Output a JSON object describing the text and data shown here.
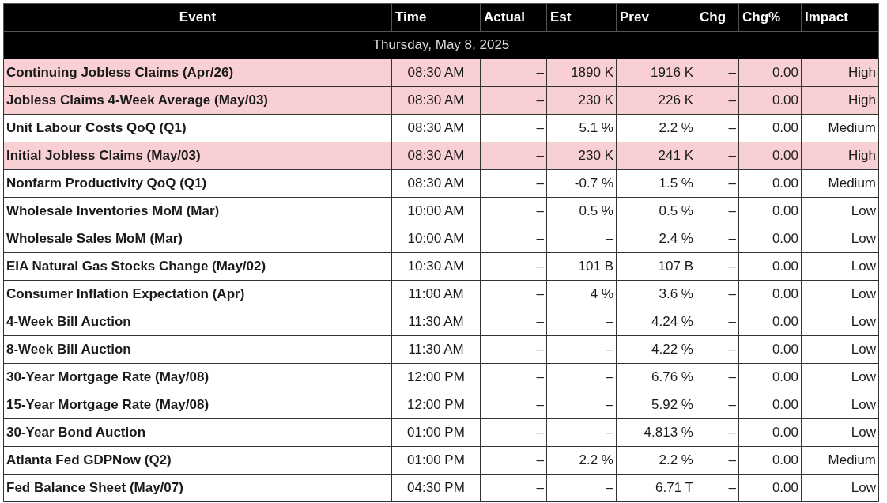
{
  "table": {
    "columns": [
      "Event",
      "Time",
      "Actual",
      "Est",
      "Prev",
      "Chg",
      "Chg%",
      "Impact"
    ],
    "date": "Thursday, May 8, 2025",
    "rows": [
      {
        "highlighted": true,
        "cells": [
          "Continuing Jobless Claims (Apr/26)",
          "08:30 AM",
          "–",
          "1890 K",
          "1916 K",
          "–",
          "0.00",
          "High"
        ]
      },
      {
        "highlighted": true,
        "cells": [
          "Jobless Claims 4-Week Average (May/03)",
          "08:30 AM",
          "–",
          "230 K",
          "226 K",
          "–",
          "0.00",
          "High"
        ]
      },
      {
        "highlighted": false,
        "cells": [
          "Unit Labour Costs QoQ (Q1)",
          "08:30 AM",
          "–",
          "5.1 %",
          "2.2 %",
          "–",
          "0.00",
          "Medium"
        ]
      },
      {
        "highlighted": true,
        "cells": [
          "Initial Jobless Claims (May/03)",
          "08:30 AM",
          "–",
          "230 K",
          "241 K",
          "–",
          "0.00",
          "High"
        ]
      },
      {
        "highlighted": false,
        "cells": [
          "Nonfarm Productivity QoQ (Q1)",
          "08:30 AM",
          "–",
          "-0.7 %",
          "1.5 %",
          "–",
          "0.00",
          "Medium"
        ]
      },
      {
        "highlighted": false,
        "cells": [
          "Wholesale Inventories MoM (Mar)",
          "10:00 AM",
          "–",
          "0.5 %",
          "0.5 %",
          "–",
          "0.00",
          "Low"
        ]
      },
      {
        "highlighted": false,
        "cells": [
          "Wholesale Sales MoM (Mar)",
          "10:00 AM",
          "–",
          "–",
          "2.4 %",
          "–",
          "0.00",
          "Low"
        ]
      },
      {
        "highlighted": false,
        "cells": [
          "EIA Natural Gas Stocks Change (May/02)",
          "10:30 AM",
          "–",
          "101 B",
          "107 B",
          "–",
          "0.00",
          "Low"
        ]
      },
      {
        "highlighted": false,
        "cells": [
          "Consumer Inflation Expectation (Apr)",
          "11:00 AM",
          "–",
          "4 %",
          "3.6 %",
          "–",
          "0.00",
          "Low"
        ]
      },
      {
        "highlighted": false,
        "cells": [
          "4-Week Bill Auction",
          "11:30 AM",
          "–",
          "–",
          "4.24 %",
          "–",
          "0.00",
          "Low"
        ]
      },
      {
        "highlighted": false,
        "cells": [
          "8-Week Bill Auction",
          "11:30 AM",
          "–",
          "–",
          "4.22 %",
          "–",
          "0.00",
          "Low"
        ]
      },
      {
        "highlighted": false,
        "cells": [
          "30-Year Mortgage Rate (May/08)",
          "12:00 PM",
          "–",
          "–",
          "6.76 %",
          "–",
          "0.00",
          "Low"
        ]
      },
      {
        "highlighted": false,
        "cells": [
          "15-Year Mortgage Rate (May/08)",
          "12:00 PM",
          "–",
          "–",
          "5.92 %",
          "–",
          "0.00",
          "Low"
        ]
      },
      {
        "highlighted": false,
        "cells": [
          "30-Year Bond Auction",
          "01:00 PM",
          "–",
          "–",
          "4.813 %",
          "–",
          "0.00",
          "Low"
        ]
      },
      {
        "highlighted": false,
        "cells": [
          "Atlanta Fed GDPNow (Q2)",
          "01:00 PM",
          "–",
          "2.2 %",
          "2.2 %",
          "–",
          "0.00",
          "Medium"
        ]
      },
      {
        "highlighted": false,
        "cells": [
          "Fed Balance Sheet (May/07)",
          "04:30 PM",
          "–",
          "–",
          "6.71 T",
          "–",
          "0.00",
          "Low"
        ]
      }
    ]
  }
}
